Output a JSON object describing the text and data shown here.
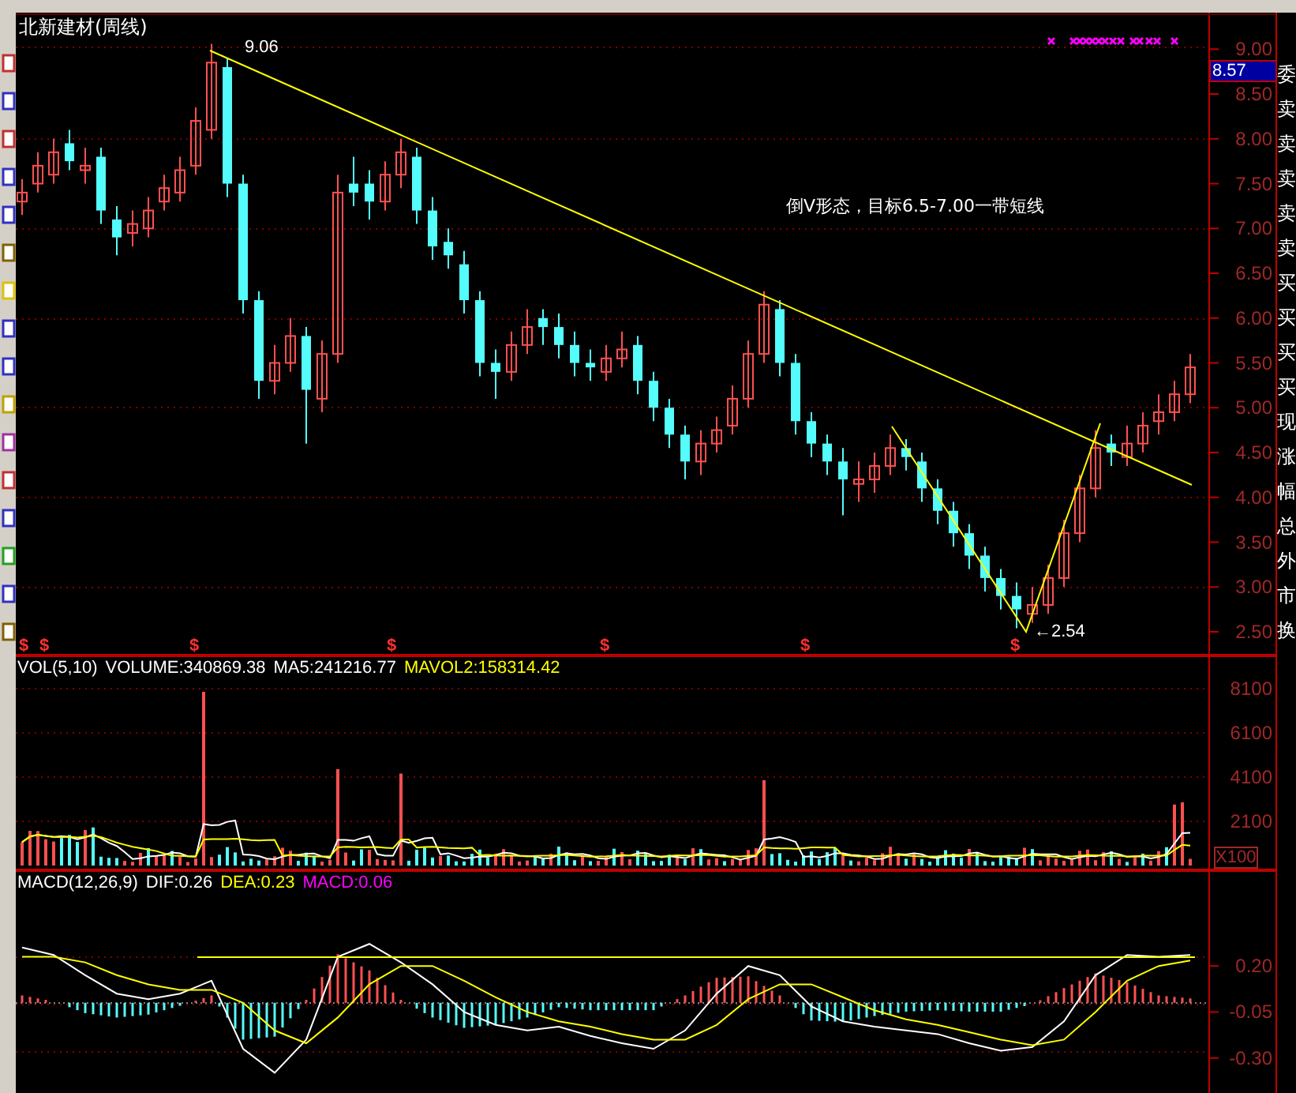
{
  "chart_title": "北新建材(周线)",
  "price_chart": {
    "chart_data": {
      "type": "candlestick",
      "ylim": [
        2.5,
        9.39
      ],
      "yticks": [
        {
          "value": 9,
          "label": "9.00"
        },
        {
          "value": 8.5,
          "label": "8.50"
        },
        {
          "value": 8,
          "label": "8.00"
        },
        {
          "value": 7.5,
          "label": "7.50"
        },
        {
          "value": 7,
          "label": "7.00"
        },
        {
          "value": 6.5,
          "label": "6.50"
        },
        {
          "value": 6,
          "label": "6.00"
        },
        {
          "value": 5.5,
          "label": "5.50"
        },
        {
          "value": 5,
          "label": "5.00"
        },
        {
          "value": 4.5,
          "label": "4.50"
        },
        {
          "value": 4,
          "label": "4.00"
        },
        {
          "value": 3.5,
          "label": "3.50"
        },
        {
          "value": 3,
          "label": "3.00"
        },
        {
          "value": 2.5,
          "label": "2.50"
        }
      ],
      "ohlc": [
        [
          7.3,
          7.55,
          7.15,
          7.4
        ],
        [
          7.5,
          7.85,
          7.4,
          7.7
        ],
        [
          7.6,
          8.0,
          7.5,
          7.85
        ],
        [
          7.95,
          8.1,
          7.65,
          7.75
        ],
        [
          7.65,
          7.9,
          7.5,
          7.7
        ],
        [
          7.8,
          7.9,
          7.05,
          7.2
        ],
        [
          7.1,
          7.25,
          6.7,
          6.9
        ],
        [
          6.95,
          7.2,
          6.8,
          7.05
        ],
        [
          7.0,
          7.35,
          6.9,
          7.2
        ],
        [
          7.3,
          7.6,
          7.2,
          7.45
        ],
        [
          7.4,
          7.8,
          7.3,
          7.65
        ],
        [
          7.7,
          8.35,
          7.6,
          8.2
        ],
        [
          8.1,
          9.06,
          8.0,
          8.85
        ],
        [
          8.8,
          8.9,
          7.35,
          7.5
        ],
        [
          7.5,
          7.6,
          6.05,
          6.2
        ],
        [
          6.2,
          6.3,
          5.1,
          5.3
        ],
        [
          5.3,
          5.7,
          5.15,
          5.5
        ],
        [
          5.5,
          6.0,
          5.4,
          5.8
        ],
        [
          5.8,
          5.9,
          4.6,
          5.2
        ],
        [
          5.1,
          5.75,
          4.95,
          5.6
        ],
        [
          5.6,
          7.6,
          5.5,
          7.4
        ],
        [
          7.5,
          7.8,
          7.25,
          7.4
        ],
        [
          7.5,
          7.65,
          7.1,
          7.3
        ],
        [
          7.3,
          7.75,
          7.2,
          7.6
        ],
        [
          7.6,
          8.0,
          7.45,
          7.85
        ],
        [
          7.8,
          7.9,
          7.05,
          7.2
        ],
        [
          7.2,
          7.35,
          6.65,
          6.8
        ],
        [
          6.85,
          7.0,
          6.55,
          6.7
        ],
        [
          6.6,
          6.75,
          6.05,
          6.2
        ],
        [
          6.2,
          6.3,
          5.35,
          5.5
        ],
        [
          5.5,
          5.65,
          5.1,
          5.4
        ],
        [
          5.4,
          5.85,
          5.3,
          5.7
        ],
        [
          5.7,
          6.1,
          5.6,
          5.9
        ],
        [
          6.0,
          6.1,
          5.7,
          5.9
        ],
        [
          5.9,
          6.05,
          5.55,
          5.7
        ],
        [
          5.7,
          5.85,
          5.35,
          5.5
        ],
        [
          5.5,
          5.65,
          5.3,
          5.45
        ],
        [
          5.4,
          5.7,
          5.3,
          5.55
        ],
        [
          5.55,
          5.85,
          5.45,
          5.65
        ],
        [
          5.7,
          5.8,
          5.15,
          5.3
        ],
        [
          5.3,
          5.4,
          4.85,
          5.0
        ],
        [
          5.0,
          5.1,
          4.55,
          4.7
        ],
        [
          4.7,
          4.8,
          4.2,
          4.4
        ],
        [
          4.4,
          4.75,
          4.25,
          4.6
        ],
        [
          4.6,
          4.9,
          4.5,
          4.75
        ],
        [
          4.8,
          5.25,
          4.7,
          5.1
        ],
        [
          5.1,
          5.75,
          5.0,
          5.6
        ],
        [
          5.6,
          6.3,
          5.5,
          6.15
        ],
        [
          6.1,
          6.2,
          5.35,
          5.5
        ],
        [
          5.5,
          5.6,
          4.7,
          4.85
        ],
        [
          4.85,
          4.95,
          4.45,
          4.6
        ],
        [
          4.6,
          4.7,
          4.25,
          4.4
        ],
        [
          4.4,
          4.55,
          3.8,
          4.2
        ],
        [
          4.15,
          4.4,
          3.95,
          4.2
        ],
        [
          4.2,
          4.5,
          4.05,
          4.35
        ],
        [
          4.35,
          4.7,
          4.25,
          4.55
        ],
        [
          4.55,
          4.65,
          4.3,
          4.45
        ],
        [
          4.4,
          4.5,
          3.95,
          4.1
        ],
        [
          4.1,
          4.2,
          3.7,
          3.85
        ],
        [
          3.85,
          3.95,
          3.45,
          3.6
        ],
        [
          3.6,
          3.7,
          3.2,
          3.35
        ],
        [
          3.35,
          3.45,
          2.95,
          3.1
        ],
        [
          3.1,
          3.2,
          2.75,
          2.9
        ],
        [
          2.9,
          3.05,
          2.54,
          2.75
        ],
        [
          2.7,
          3.0,
          2.6,
          2.8
        ],
        [
          2.8,
          3.25,
          2.7,
          3.1
        ],
        [
          3.1,
          3.75,
          3.0,
          3.6
        ],
        [
          3.6,
          4.25,
          3.5,
          4.1
        ],
        [
          4.1,
          4.75,
          4.0,
          4.55
        ],
        [
          4.6,
          4.7,
          4.35,
          4.5
        ],
        [
          4.45,
          4.8,
          4.35,
          4.6
        ],
        [
          4.6,
          4.95,
          4.5,
          4.8
        ],
        [
          4.85,
          5.15,
          4.7,
          4.95
        ],
        [
          4.95,
          5.3,
          4.85,
          5.15
        ],
        [
          5.15,
          5.6,
          5.05,
          5.45
        ]
      ]
    }
  },
  "current_price": "8.57",
  "high_label": "9.06",
  "low_label": "←2.54",
  "annotation": "倒V形态，目标6.5-7.00一带短线",
  "buy_signals": [
    "$",
    "$",
    "$",
    "$",
    "$",
    "$",
    "$"
  ],
  "volume_header": [
    {
      "text": "VOL(5,10)",
      "color": "#ffffff"
    },
    {
      "text": "VOLUME:340869.38",
      "color": "#ffffff"
    },
    {
      "text": "MA5:241216.77",
      "color": "#ffffff"
    },
    {
      "text": "MAVOL2:158314.42",
      "color": "#ffff00"
    }
  ],
  "volume_axis": [
    "8100",
    "6100",
    "4100",
    "2100"
  ],
  "volume_unit": "X100",
  "macd_header": [
    {
      "text": "MACD(12,26,9)",
      "color": "#ffffff"
    },
    {
      "text": "DIF:0.26",
      "color": "#ffffff"
    },
    {
      "text": "DEA:0.23",
      "color": "#ffff00"
    },
    {
      "text": "MACD:0.06",
      "color": "#ff00ff"
    }
  ],
  "macd_chart": {
    "chart_data": {
      "type": "line",
      "ylim": [
        -0.49,
        0.72
      ],
      "yticks": [
        {
          "value": 0.2,
          "label": "0.20"
        },
        {
          "value": -0.05,
          "label": "-0.05"
        },
        {
          "value": -0.3,
          "label": "-0.30"
        }
      ],
      "series": [
        {
          "color": "#ffffff",
          "values": [
            0.3,
            0.26,
            0.15,
            0.05,
            0.02,
            0.05,
            0.12,
            -0.25,
            -0.38,
            -0.2,
            0.25,
            0.32,
            0.22,
            0.1,
            -0.05,
            -0.12,
            -0.15,
            -0.13,
            -0.18,
            -0.22,
            -0.25,
            -0.15,
            0.05,
            0.2,
            0.15,
            -0.02,
            -0.1,
            -0.13,
            -0.15,
            -0.17,
            -0.22,
            -0.26,
            -0.24,
            -0.1,
            0.15,
            0.26,
            0.25,
            0.26
          ]
        },
        {
          "color": "#ffff00",
          "values": [
            0.25,
            0.25,
            0.22,
            0.15,
            0.1,
            0.07,
            0.07,
            0.0,
            -0.15,
            -0.22,
            -0.08,
            0.1,
            0.2,
            0.2,
            0.12,
            0.03,
            -0.05,
            -0.1,
            -0.13,
            -0.17,
            -0.2,
            -0.2,
            -0.12,
            0.02,
            0.1,
            0.1,
            0.03,
            -0.04,
            -0.09,
            -0.12,
            -0.16,
            -0.2,
            -0.23,
            -0.2,
            -0.05,
            0.12,
            0.2,
            0.23
          ]
        }
      ]
    }
  },
  "side_panel_labels": [
    "委",
    "卖",
    "卖",
    "卖",
    "卖",
    "卖",
    "买",
    "买",
    "买",
    "买",
    "现",
    "涨",
    "幅",
    "总",
    "外",
    "市",
    "换"
  ]
}
